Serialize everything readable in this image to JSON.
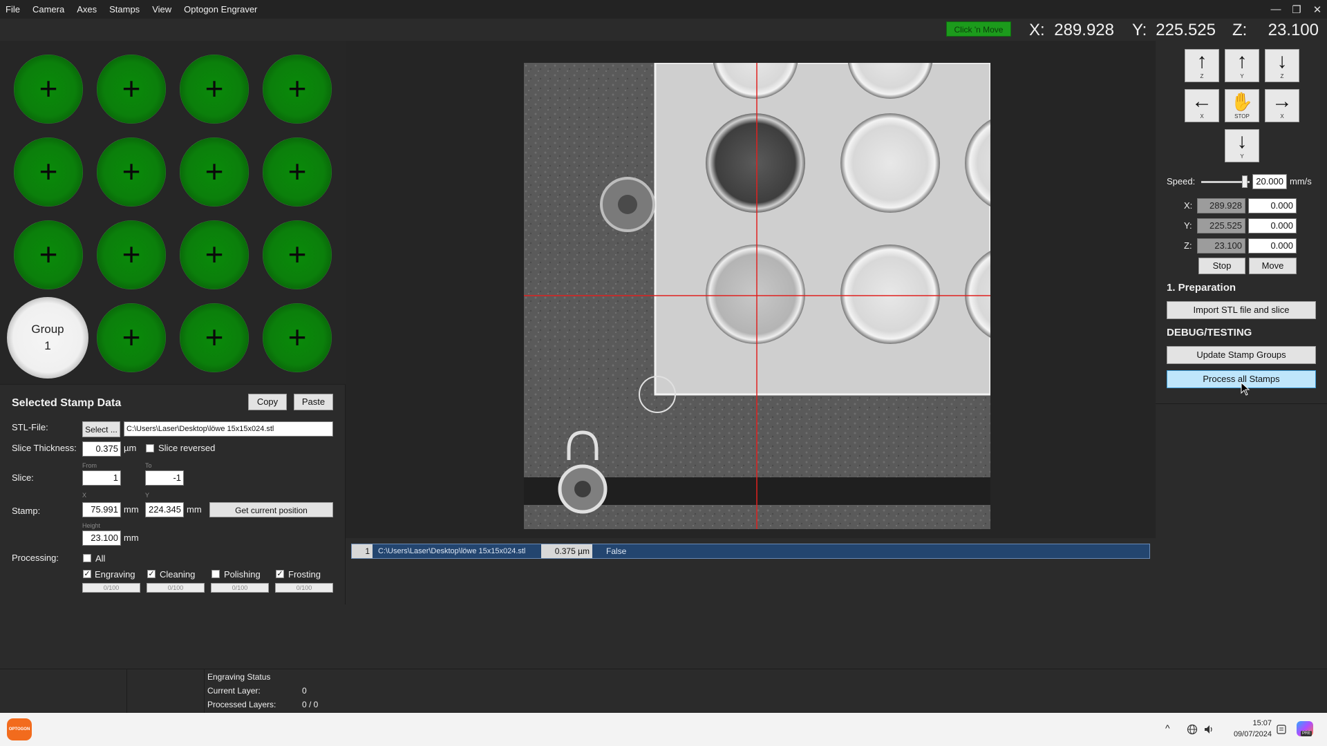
{
  "menu": [
    "File",
    "Camera",
    "Axes",
    "Stamps",
    "View",
    "Optogon Engraver"
  ],
  "window_controls": [
    "—",
    "❐",
    "✕"
  ],
  "position": {
    "click_move_label": "Click 'n Move",
    "x_label": "X:",
    "x_value": "289.928",
    "y_label": "Y:",
    "y_value": "225.525",
    "z_label": "Z:",
    "z_value": "23.100"
  },
  "stamps": {
    "plus_symbol": "+",
    "group_label": "Group",
    "group_number": "1"
  },
  "stamp_data": {
    "title": "Selected Stamp Data",
    "copy_label": "Copy",
    "paste_label": "Paste",
    "stl_label": "STL-File:",
    "select_label": "Select ...",
    "stl_path": "C:\\Users\\Laser\\Desktop\\löwe 15x15x024.stl",
    "slice_thickness_label": "Slice Thickness:",
    "slice_thickness_value": "0.375",
    "slice_thickness_unit": "µm",
    "slice_reversed_label": "Slice reversed",
    "slice_label": "Slice:",
    "from_label": "From",
    "from_value": "1",
    "to_label": "To",
    "to_value": "-1",
    "stamp_label": "Stamp:",
    "x_small": "X",
    "y_small": "Y",
    "stamp_x": "75.991",
    "stamp_y": "224.345",
    "mm": "mm",
    "get_position_label": "Get current position",
    "height_label": "Height",
    "height_value": "23.100",
    "processing_label": "Processing:",
    "all_label": "All",
    "check_mark": "✓",
    "engraving_label": "Engraving",
    "cleaning_label": "Cleaning",
    "polishing_label": "Polishing",
    "frosting_label": "Frosting",
    "progress_text": "0/100"
  },
  "status_row": {
    "index": "1",
    "path": "C:\\Users\\Laser\\Desktop\\löwe 15x15x024.stl",
    "thickness": "0.375 µm",
    "reversed": "False"
  },
  "controls": {
    "up_glyph": "↑",
    "down_glyph": "↓",
    "left_glyph": "←",
    "right_glyph": "→",
    "stop_glyph": "✋",
    "z_label": "Z",
    "y_label": "Y",
    "x_label": "X",
    "stop_label": "STOP",
    "speed_label": "Speed:",
    "speed_value": "20.000",
    "speed_unit": "mm/s",
    "speed_slider_fraction": 0.95,
    "x_label_full": "X:",
    "y_label_full": "Y:",
    "z_label_full": "Z:",
    "x_current": "289.928",
    "y_current": "225.525",
    "z_current": "23.100",
    "x_target": "0.000",
    "y_target": "0.000",
    "z_target": "0.000",
    "stop_button": "Stop",
    "move_button": "Move",
    "preparation_title": "1. Preparation",
    "import_button": "Import STL file and slice",
    "debug_title": "DEBUG/TESTING",
    "update_button": "Update Stamp Groups",
    "process_button": "Process all Stamps"
  },
  "engraving_status": {
    "title": "Engraving Status",
    "current_layer_label": "Current Layer:",
    "current_layer_value": "0",
    "processed_label": "Processed Layers:",
    "processed_value": "0 / 0"
  },
  "taskbar": {
    "app_label": "OPTOGON",
    "time": "15:07",
    "date": "09/07/2024",
    "badge": "PRE"
  },
  "colors": {
    "stamp_green": "#0b7f0b",
    "click_move_green": "#1c9b1c",
    "status_row_blue": "#23456f",
    "process_button_highlight": "#bfe6fb",
    "crosshair_red": "#e0211f",
    "optogon_orange": "#f26b1d"
  }
}
